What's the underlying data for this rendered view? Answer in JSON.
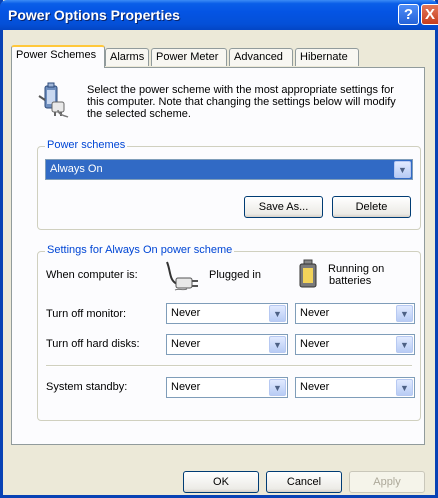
{
  "window": {
    "title": "Power Options Properties",
    "help_label": "?",
    "close_label": "X"
  },
  "tabs": [
    {
      "label": "Power Schemes",
      "active": true
    },
    {
      "label": "Alarms",
      "active": false
    },
    {
      "label": "Power Meter",
      "active": false
    },
    {
      "label": "Advanced",
      "active": false
    },
    {
      "label": "Hibernate",
      "active": false
    }
  ],
  "intro": {
    "line1": "Select the power scheme with the most appropriate settings for",
    "line2": "this computer. Note that changing the settings below will modify",
    "line3": "the selected scheme."
  },
  "power_schemes": {
    "legend": "Power schemes",
    "selected": "Always On",
    "save_as_label": "Save As...",
    "delete_label": "Delete"
  },
  "settings": {
    "legend": "Settings for Always On power scheme",
    "when_label": "When computer is:",
    "plugged_in_label": "Plugged in",
    "batteries_line1": "Running on",
    "batteries_line2": "batteries",
    "monitor": {
      "label": "Turn off monitor:",
      "plugged": "Never",
      "battery": "Never"
    },
    "hard_disks": {
      "label": "Turn off hard disks:",
      "plugged": "Never",
      "battery": "Never"
    },
    "standby": {
      "label": "System standby:",
      "plugged": "Never",
      "battery": "Never"
    }
  },
  "footer": {
    "ok_label": "OK",
    "cancel_label": "Cancel",
    "apply_label": "Apply"
  }
}
